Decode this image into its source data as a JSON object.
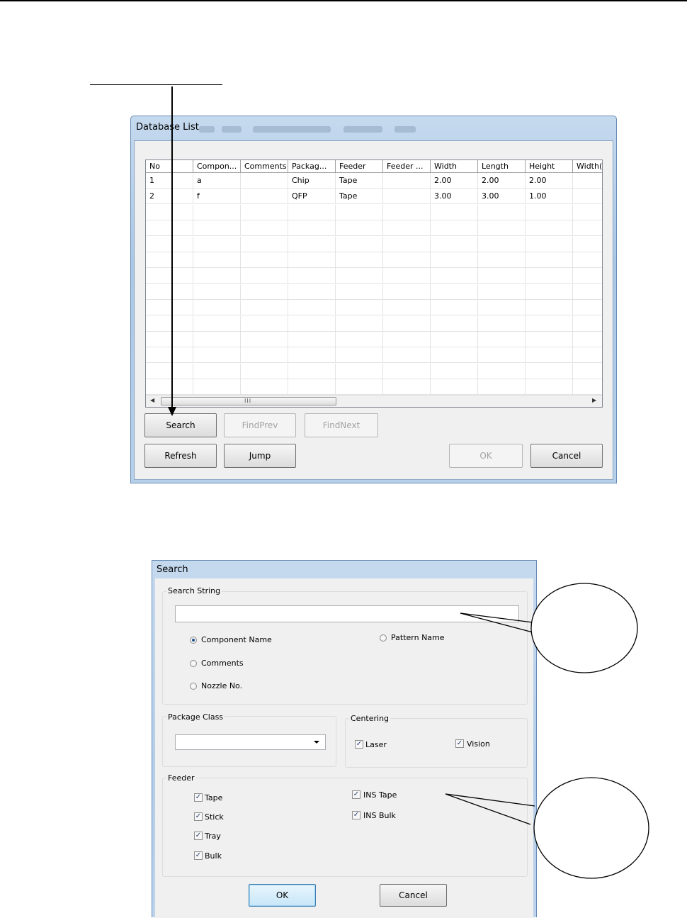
{
  "database_list": {
    "title": "Database List",
    "columns": [
      "No",
      "Compon...",
      "Comments",
      "Packag...",
      "Feeder",
      "Feeder ...",
      "Width",
      "Length",
      "Height",
      "Width("
    ],
    "rows": [
      [
        "1",
        "a",
        "",
        "Chip",
        "Tape",
        "",
        "2.00",
        "2.00",
        "2.00",
        ""
      ],
      [
        "2",
        "f",
        "",
        "QFP",
        "Tape",
        "",
        "3.00",
        "3.00",
        "1.00",
        ""
      ]
    ],
    "scroll_grip": "III",
    "buttons": {
      "search": "Search",
      "find_prev": "FindPrev",
      "find_next": "FindNext",
      "refresh": "Refresh",
      "jump": "Jump",
      "ok": "OK",
      "cancel": "Cancel"
    }
  },
  "search_dialog": {
    "title": "Search",
    "search_string_group": "Search String",
    "search_value": "",
    "radios": {
      "component_name": "Component Name",
      "pattern_name": "Pattern Name",
      "comments": "Comments",
      "nozzle_no": "Nozzle No."
    },
    "package_class_group": "Package Class",
    "package_class_value": "",
    "centering_group": "Centering",
    "centering": {
      "laser": "Laser",
      "vision": "Vision"
    },
    "feeder_group": "Feeder",
    "feeder": {
      "tape": "Tape",
      "stick": "Stick",
      "tray": "Tray",
      "bulk": "Bulk",
      "ins_tape": "INS Tape",
      "ins_bulk": "INS Bulk"
    },
    "buttons": {
      "ok": "OK",
      "cancel": "Cancel"
    }
  }
}
